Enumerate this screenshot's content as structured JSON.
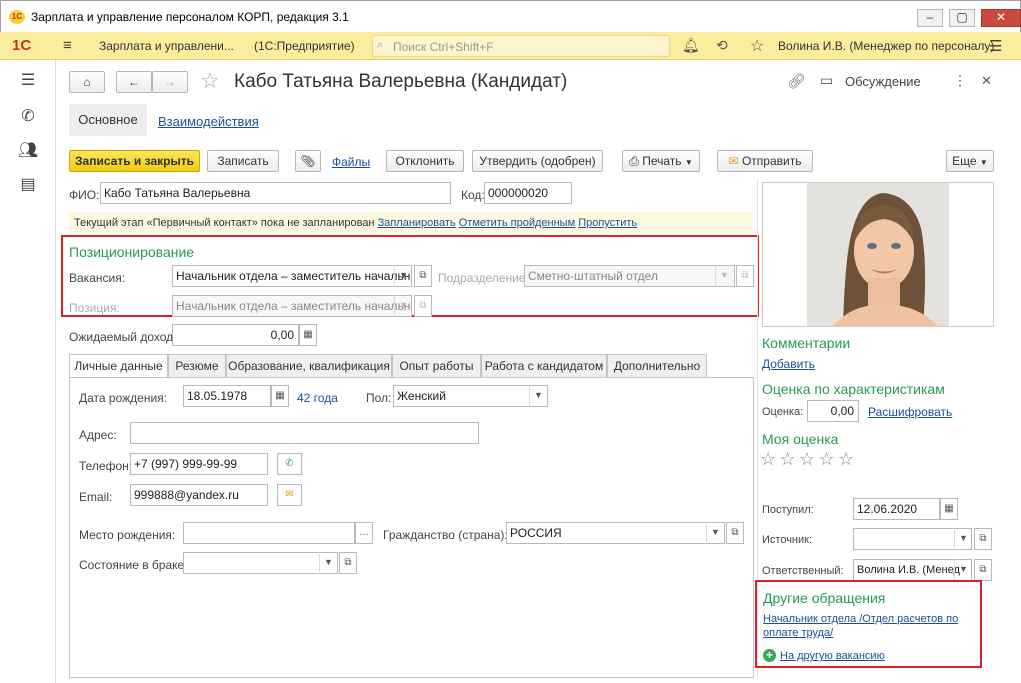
{
  "window": {
    "title": "Зарплата и управление персоналом КОРП, редакция 3.1"
  },
  "apptoolbar": {
    "logo": "1С",
    "app_name": "Зарплата и управлени...",
    "platform": "(1С:Предприятие)",
    "search_placeholder": "Поиск Ctrl+Shift+F",
    "user": "Волина И.В. (Менеджер по персоналу)"
  },
  "form": {
    "title": "Кабо Татьяна Валерьевна (Кандидат)",
    "discussion": "Обсуждение",
    "tabs_top": [
      "Основное",
      "Взаимодействия"
    ],
    "actions": {
      "save_close": "Записать и закрыть",
      "save": "Записать",
      "files": "Файлы",
      "reject": "Отклонить",
      "approve": "Утвердить (одобрен)",
      "print": "Печать",
      "send": "Отправить",
      "more": "Еще"
    },
    "fio_label": "ФИО:",
    "fio_value": "Кабо Татьяна Валерьевна",
    "code_label": "Код:",
    "code_value": "000000020",
    "stage_text": "Текущий этап «Первичный контакт» пока не запланирован",
    "stage_links": [
      "Запланировать",
      "Отметить пройденным",
      "Пропустить"
    ],
    "positioning": {
      "title": "Позиционирование",
      "vacancy_label": "Вакансия:",
      "vacancy_value": "Начальник отдела – заместитель начальни",
      "division_label": "Подразделение:",
      "division_value": "Сметно-штатный отдел",
      "position_label": "Позиция:",
      "position_value": "Начальник отдела – заместитель начальни"
    },
    "income_label": "Ожидаемый доход:",
    "income_value": "0,00",
    "tabs": [
      "Личные данные",
      "Резюме",
      "Образование, квалификация",
      "Опыт работы",
      "Работа с кандидатом",
      "Дополнительно"
    ],
    "personal": {
      "birth_label": "Дата рождения:",
      "birth_value": "18.05.1978",
      "age": "42 года",
      "sex_label": "Пол:",
      "sex_value": "Женский",
      "address_label": "Адрес:",
      "address_value": "",
      "phone_label": "Телефон:",
      "phone_value": "+7 (997) 999-99-99",
      "email_label": "Email:",
      "email_value": "999888@yandex.ru",
      "birthplace_label": "Место рождения:",
      "birthplace_value": "",
      "citizenship_label": "Гражданство (страна):",
      "citizenship_value": "РОССИЯ",
      "marital_label": "Состояние в браке:",
      "marital_value": ""
    }
  },
  "side": {
    "comments_title": "Комментарии",
    "comments_add": "Добавить",
    "rating_title": "Оценка по характеристикам",
    "rating_label": "Оценка:",
    "rating_value": "0,00",
    "rating_link": "Расшифровать",
    "my_rating_title": "Моя оценка",
    "stars": 5,
    "received_label": "Поступил:",
    "received_value": "12.06.2020",
    "source_label": "Источник:",
    "source_value": "",
    "resp_label": "Ответственный:",
    "resp_value": "Волина И.В. (Менед",
    "other_title": "Другие обращения",
    "other_link": "Начальник отдела /Отдел расчетов по оплате труда/",
    "other_new": "На другую вакансию"
  },
  "colors": {
    "accent_yellow": "#fbed9e",
    "button_yellow": "#f2cd11",
    "section_green": "#279a55",
    "link_blue": "#1a4f9e",
    "highlight_red": "#d9232a"
  }
}
